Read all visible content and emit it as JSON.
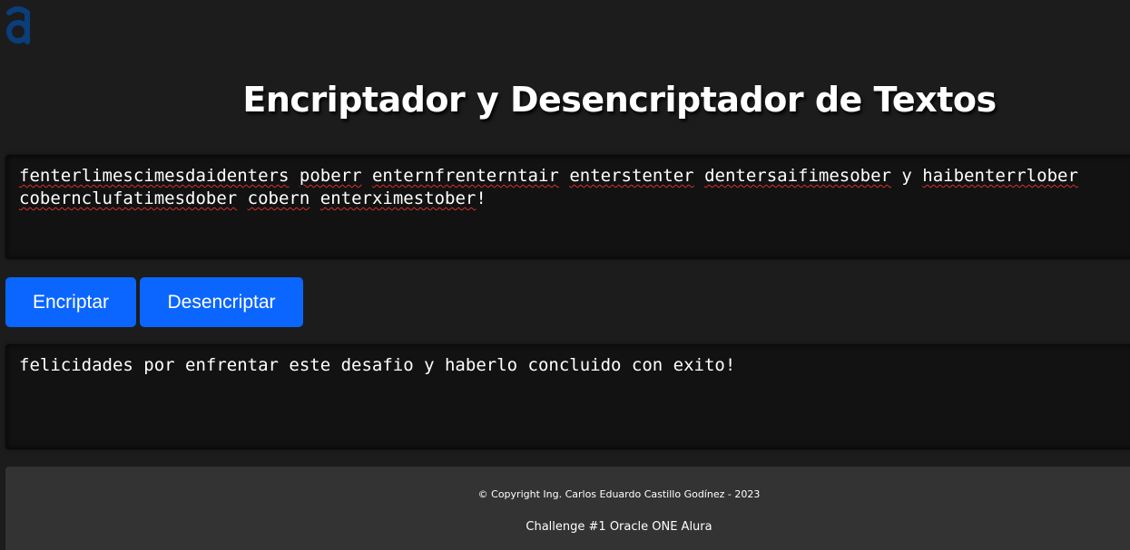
{
  "header": {
    "logo_icon": "alura-a-logo",
    "logo_color": "#0b3d7a",
    "title": "Encriptador y Desencriptador de Textos"
  },
  "input": {
    "value": "fenterlimescimesdaidenters poberr enternfrenterntair enterstenter dentersaifimesober y haibenterrlober cobernclufatimesdober cobern enterximestober!",
    "words": [
      "fenterlimescimesdaidenters",
      " ",
      "poberr",
      " ",
      "enternfrenterntair",
      " ",
      "enterstenter",
      " ",
      "dentersaifimesober",
      " y ",
      "haibenterrlober",
      " ",
      "cobernclufatimesdober",
      " ",
      "cobern",
      " ",
      "enterximestober",
      "!"
    ]
  },
  "buttons": {
    "encrypt_label": "Encriptar",
    "decrypt_label": "Desencriptar",
    "color": "#0a66ff"
  },
  "output": {
    "value": "felicidades por enfrentar este desafio y haberlo concluido con exito!"
  },
  "footer": {
    "copyright": "© Copyright Ing. Carlos Eduardo Castillo Godínez - 2023",
    "challenge": "Challenge #1 Oracle ONE Alura"
  }
}
